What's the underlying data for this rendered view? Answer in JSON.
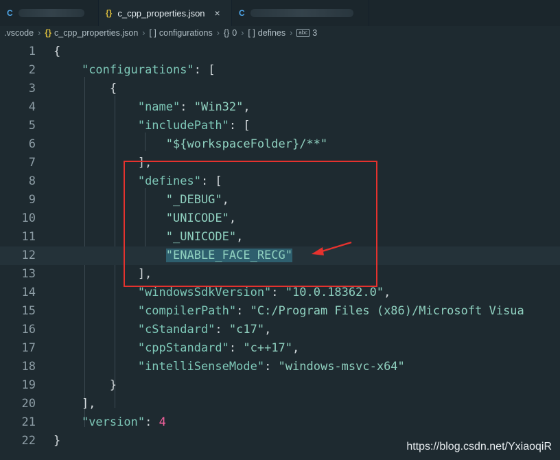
{
  "tabs": [
    {
      "label": "",
      "icon": "c-file-icon",
      "blurred": true
    },
    {
      "label": "c_cpp_properties.json",
      "icon": "json-icon",
      "active": true
    },
    {
      "label": "",
      "icon": "c-file-icon",
      "blurred": true
    }
  ],
  "tab_close_glyph": "×",
  "breadcrumb": [
    {
      "label": ".vscode",
      "icon": ""
    },
    {
      "label": "c_cpp_properties.json",
      "icon": "{}"
    },
    {
      "label": "configurations",
      "icon": "[ ]"
    },
    {
      "label": "0",
      "icon": "{}"
    },
    {
      "label": "defines",
      "icon": "[ ]"
    },
    {
      "label": "3",
      "icon": "abc"
    }
  ],
  "code_lines": [
    {
      "n": "1",
      "text": "{"
    },
    {
      "n": "2",
      "text": "    \"configurations\": ["
    },
    {
      "n": "3",
      "text": "        {"
    },
    {
      "n": "4",
      "text": "            \"name\": \"Win32\","
    },
    {
      "n": "5",
      "text": "            \"includePath\": ["
    },
    {
      "n": "6",
      "text": "                \"${workspaceFolder}/**\""
    },
    {
      "n": "7",
      "text": "            ],"
    },
    {
      "n": "8",
      "text": "            \"defines\": ["
    },
    {
      "n": "9",
      "text": "                \"_DEBUG\","
    },
    {
      "n": "10",
      "text": "                \"UNICODE\","
    },
    {
      "n": "11",
      "text": "                \"_UNICODE\","
    },
    {
      "n": "12",
      "text": "                \"ENABLE_FACE_RECG\""
    },
    {
      "n": "13",
      "text": "            ],"
    },
    {
      "n": "14",
      "text": "            \"windowsSdkVersion\": \"10.0.18362.0\","
    },
    {
      "n": "15",
      "text": "            \"compilerPath\": \"C:/Program Files (x86)/Microsoft Visua"
    },
    {
      "n": "16",
      "text": "            \"cStandard\": \"c17\","
    },
    {
      "n": "17",
      "text": "            \"cppStandard\": \"c++17\","
    },
    {
      "n": "18",
      "text": "            \"intelliSenseMode\": \"windows-msvc-x64\""
    },
    {
      "n": "19",
      "text": "        }"
    },
    {
      "n": "20",
      "text": "    ],"
    },
    {
      "n": "21",
      "text": "    \"version\": 4"
    },
    {
      "n": "22",
      "text": "}"
    }
  ],
  "current_line": "12",
  "watermark": "https://blog.csdn.net/YxiaoqiR",
  "colors": {
    "key": "#7ec8b8",
    "number": "#f0609b",
    "annotation": "#e5322e",
    "background": "#1e2a30"
  }
}
